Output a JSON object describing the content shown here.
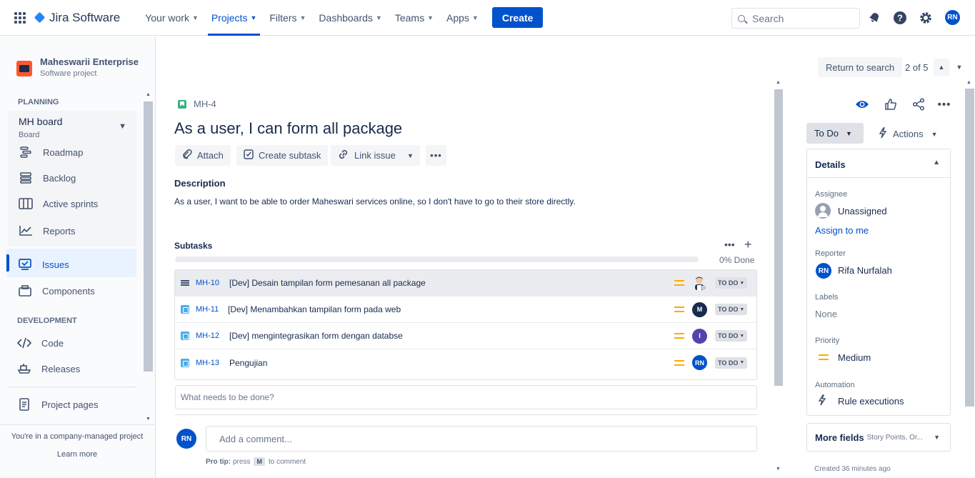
{
  "topbar": {
    "product": "Jira Software",
    "nav": [
      {
        "label": "Your work",
        "active": false
      },
      {
        "label": "Projects",
        "active": true
      },
      {
        "label": "Filters",
        "active": false
      },
      {
        "label": "Dashboards",
        "active": false
      },
      {
        "label": "Teams",
        "active": false
      },
      {
        "label": "Apps",
        "active": false
      }
    ],
    "create_label": "Create",
    "search_placeholder": "Search",
    "user_initials": "RN",
    "icons": [
      "apps-grid-icon",
      "notifications-icon",
      "help-icon",
      "settings-icon"
    ]
  },
  "sidebar": {
    "project_name": "Maheswarii Enterprise",
    "project_type": "Software project",
    "planning_title": "PLANNING",
    "board_name": "MH board",
    "board_sub": "Board",
    "planning_items": [
      {
        "label": "Roadmap",
        "icon": "roadmap-icon"
      },
      {
        "label": "Backlog",
        "icon": "backlog-icon"
      },
      {
        "label": "Active sprints",
        "icon": "board-icon"
      },
      {
        "label": "Reports",
        "icon": "reports-icon"
      }
    ],
    "issues_label": "Issues",
    "components_label": "Components",
    "development_title": "DEVELOPMENT",
    "code_label": "Code",
    "releases_label": "Releases",
    "project_pages_label": "Project pages",
    "footer_text": "You're in a company-managed project",
    "learn_more": "Learn more"
  },
  "issue": {
    "key": "MH-4",
    "title": "As a user, I can form all package",
    "buttons": {
      "attach": "Attach",
      "create_subtask": "Create subtask",
      "link_issue": "Link issue"
    },
    "description_title": "Description",
    "description": "As a user, I want to be able to order Maheswari services online, so I don't have to go to their store directly.",
    "subtasks_title": "Subtasks",
    "progress_done_fraction": 0,
    "done_text": "0% Done",
    "subtasks": [
      {
        "key": "MH-10",
        "summary": "[Dev] Desain tampilan form pemesanan all package",
        "status": "TO DO",
        "avatar": "",
        "avatar_color": "#ffc400",
        "priority": "Medium"
      },
      {
        "key": "MH-11",
        "summary": "[Dev] Menambahkan tampilan form pada web",
        "status": "TO DO",
        "avatar": "M",
        "avatar_color": "#172b4d",
        "priority": "Medium"
      },
      {
        "key": "MH-12",
        "summary": "[Dev] mengintegrasikan form dengan databse",
        "status": "TO DO",
        "avatar": "I",
        "avatar_color": "#5243aa",
        "priority": "Medium"
      },
      {
        "key": "MH-13",
        "summary": "Pengujian",
        "status": "TO DO",
        "avatar": "RN",
        "avatar_color": "#0052cc",
        "priority": "Medium"
      }
    ],
    "new_subtask_placeholder": "What needs to be done?",
    "comment_placeholder": "Add a comment...",
    "protip_label": "Pro tip:",
    "protip_press": "press",
    "protip_key": "M",
    "protip_rest": "to comment"
  },
  "right_panel": {
    "return_label": "Return to search",
    "pager": "2 of 5",
    "status_label": "To Do",
    "actions_label": "Actions",
    "details_title": "Details",
    "assignee_label": "Assignee",
    "assignee_value": "Unassigned",
    "assign_to_me": "Assign to me",
    "reporter_label": "Reporter",
    "reporter_initials": "RN",
    "reporter_value": "Rifa Nurfalah",
    "labels_label": "Labels",
    "labels_value": "None",
    "priority_label": "Priority",
    "priority_value": "Medium",
    "automation_label": "Automation",
    "automation_value": "Rule executions",
    "more_fields": "More fields",
    "more_fields_sub": "Story Points, Or...",
    "created": "Created 36 minutes ago"
  }
}
